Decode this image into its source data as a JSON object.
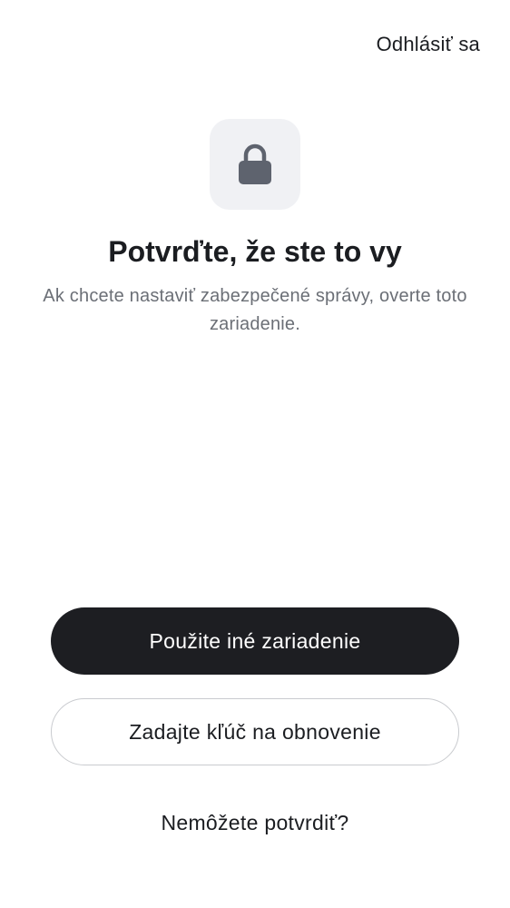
{
  "header": {
    "signout_label": "Odhlásiť sa"
  },
  "hero": {
    "icon": "lock-icon",
    "title": "Potvrďte, že ste to vy",
    "subtitle": "Ak chcete nastaviť zabezpečené správy, overte toto zariadenie."
  },
  "actions": {
    "primary_label": "Použite iné zariadenie",
    "secondary_label": "Zadajte kľúč na obnovenie",
    "help_label": "Nemôžete potvrdiť?"
  },
  "colors": {
    "primary_button_bg": "#1d1e22",
    "icon_tile_bg": "#f0f1f4",
    "icon_color": "#5e636e",
    "subtitle_text": "#6b6f76"
  }
}
